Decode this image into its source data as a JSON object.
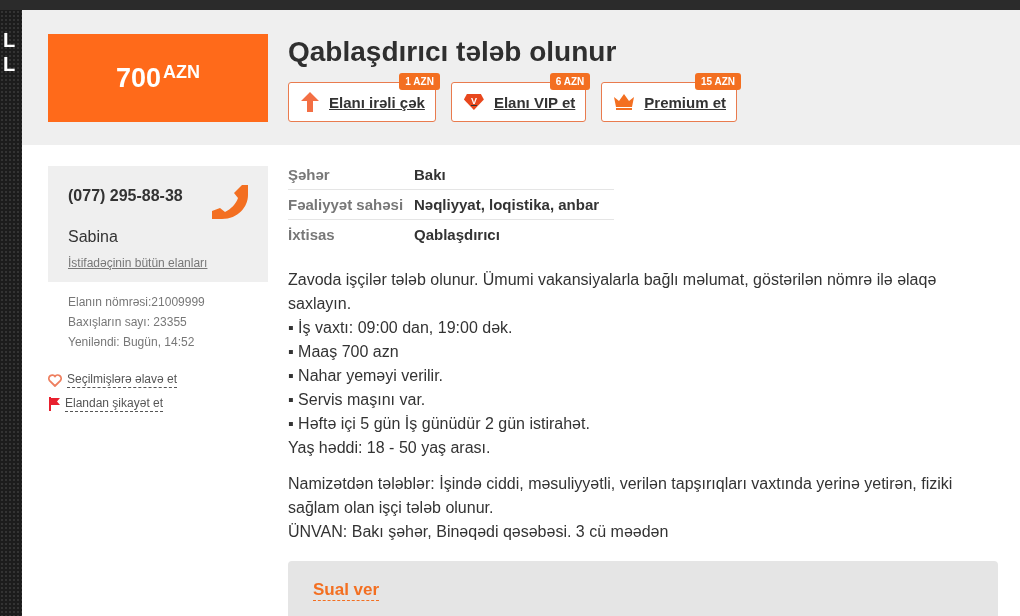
{
  "side_banner": {
    "letters": [
      "L",
      "L"
    ]
  },
  "price": {
    "amount": "700",
    "currency": "AZN"
  },
  "title": "Qablaşdırıcı tələb olunur",
  "promo_buttons": [
    {
      "kind": "up",
      "label": "Elanı irəli çək",
      "badge": "1 AZN"
    },
    {
      "kind": "vip",
      "label": "Elanı VIP et",
      "badge": "6 AZN",
      "icon_text": "V"
    },
    {
      "kind": "premium",
      "label": "Premium et",
      "badge": "15 AZN"
    }
  ],
  "contact": {
    "phone": "(077) 295-88-38",
    "name": "Sabina",
    "all_ads_link": "İstifadəçinin bütün elanları"
  },
  "stats": [
    "Elanın nömrəsi:21009999",
    "Baxışların sayı: 23355",
    "Yeniləndi: Bugün, 14:52"
  ],
  "actions": [
    {
      "kind": "favorite",
      "label": "Seçilmişlərə əlavə et"
    },
    {
      "kind": "report",
      "label": "Elandan şikayət et"
    }
  ],
  "properties": [
    {
      "name": "Şəhər",
      "value": "Bakı"
    },
    {
      "name": "Fəaliyyət sahəsi",
      "value": "Nəqliyyat, loqistika, anbar"
    },
    {
      "name": "İxtisas",
      "value": "Qablaşdırıcı"
    }
  ],
  "description": [
    {
      "lines": [
        "Zavoda işçilər tələb olunur. Ümumi vakansiyalarla bağlı məlumat, göstərilən nömrə ilə əlaqə saxlayın.",
        "▪ İş vaxtı: 09:00 dan, 19:00 dək.",
        "▪ Maaş 700 azn",
        "▪ Nahar yeməyi verilir.",
        "▪ Servis maşını var.",
        "▪ Həftə içi 5 gün İş günüdür 2 gün istirahət.",
        "Yaş həddi: 18 - 50 yaş arası."
      ]
    },
    {
      "lines": [
        "Namizətdən tələblər: İşində ciddi, məsuliyyətli, verilən tapşırıqları vaxtında yerinə yetirən, fiziki sağlam olan işçi tələb olunur.",
        "ÜNVAN: Bakı şəhər, Binəqədi qəsəbəsi. 3 cü məədən"
      ]
    }
  ],
  "question_box": {
    "title": "Sual ver"
  }
}
